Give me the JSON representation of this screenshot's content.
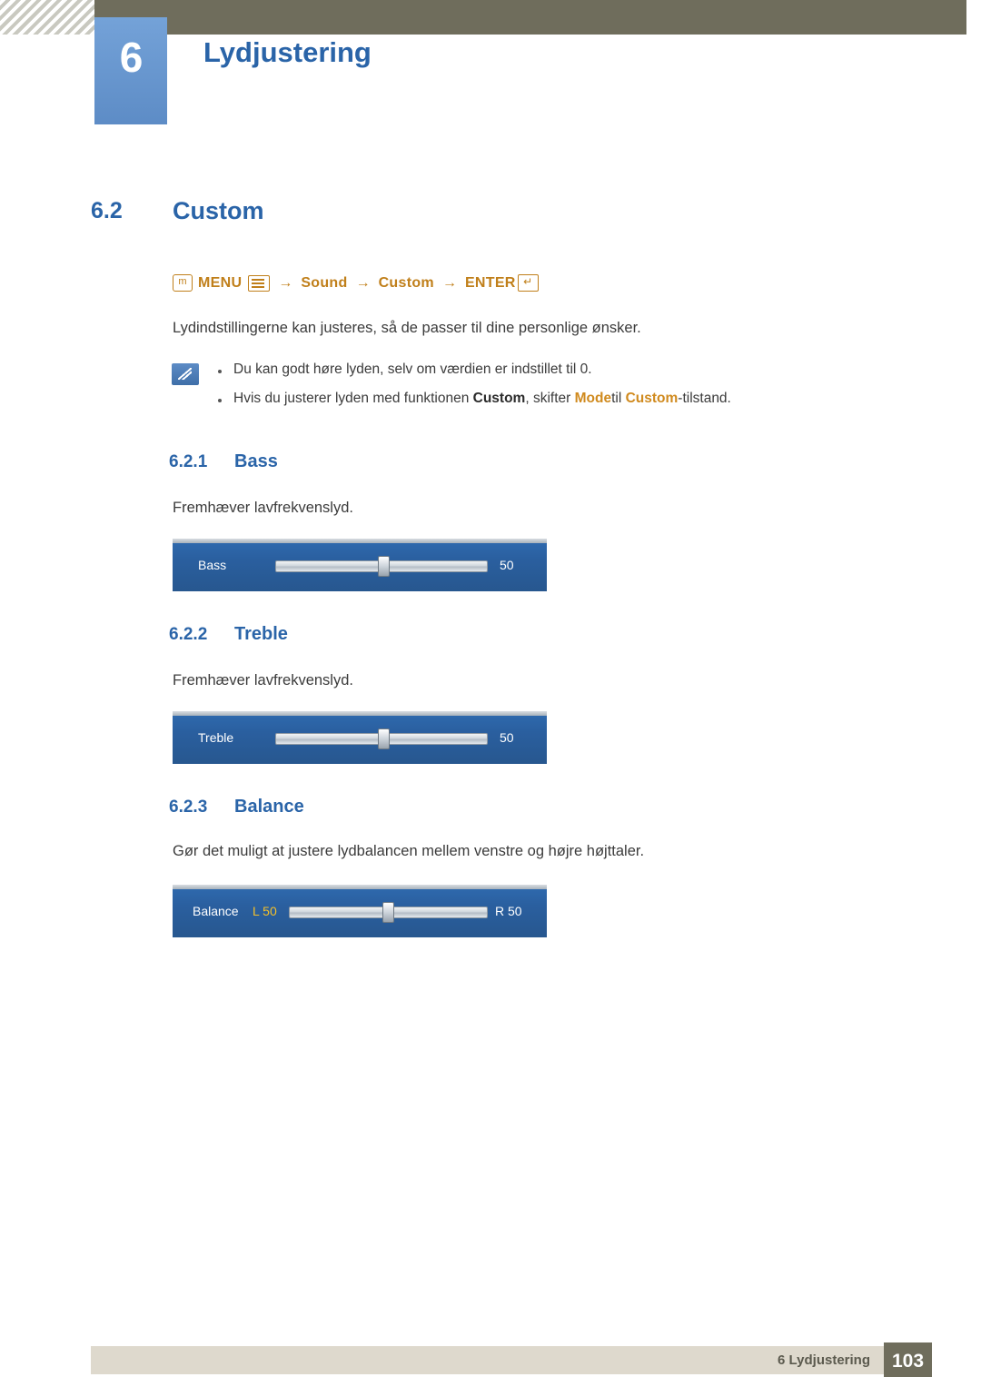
{
  "header": {
    "chapter_number": "6",
    "chapter_title": "Lydjustering"
  },
  "section": {
    "number": "6.2",
    "title": "Custom"
  },
  "menu_path": {
    "m_glyph": "m",
    "menu_label": "MENU",
    "arrow": "→",
    "sound_label": "Sound",
    "custom_label": "Custom",
    "enter_label": "ENTER"
  },
  "intro_paragraph": "Lydindstillingerne kan justeres, så de passer til dine personlige ønsker.",
  "notes": [
    {
      "parts": [
        {
          "text": "Du kan godt høre lyden, selv om værdien er indstillet til 0.",
          "style": "normal"
        }
      ]
    },
    {
      "parts": [
        {
          "text": "Hvis du justerer lyden med funktionen ",
          "style": "normal"
        },
        {
          "text": "Custom",
          "style": "dark"
        },
        {
          "text": ", skifter ",
          "style": "normal"
        },
        {
          "text": "Mode",
          "style": "orange"
        },
        {
          "text": "til ",
          "style": "normal"
        },
        {
          "text": "Custom",
          "style": "orange"
        },
        {
          "text": "-tilstand.",
          "style": "normal"
        }
      ]
    }
  ],
  "subsections": [
    {
      "number": "6.2.1",
      "title": "Bass",
      "description": "Fremhæver lavfrekvenslyd.",
      "osd": {
        "label": "Bass",
        "left_value": "",
        "value": "50",
        "knob_percent": 50
      }
    },
    {
      "number": "6.2.2",
      "title": "Treble",
      "description": "Fremhæver lavfrekvenslyd.",
      "osd": {
        "label": "Treble",
        "left_value": "",
        "value": "50",
        "knob_percent": 50
      }
    },
    {
      "number": "6.2.3",
      "title": "Balance",
      "description": "Gør det muligt at justere lydbalancen mellem venstre og højre højttaler.",
      "osd": {
        "label": "Balance",
        "left_value": "L  50",
        "value": "R  50",
        "knob_percent": 50
      }
    }
  ],
  "footer": {
    "text": "6 Lydjustering",
    "page_number": "103"
  },
  "colors": {
    "accent_blue": "#2a64a8",
    "header_bar": "#6f6d5c",
    "menu_orange": "#c07f1a",
    "osd_blue": "#2a5f9f",
    "osd_value_yellow": "#f3c02a"
  }
}
